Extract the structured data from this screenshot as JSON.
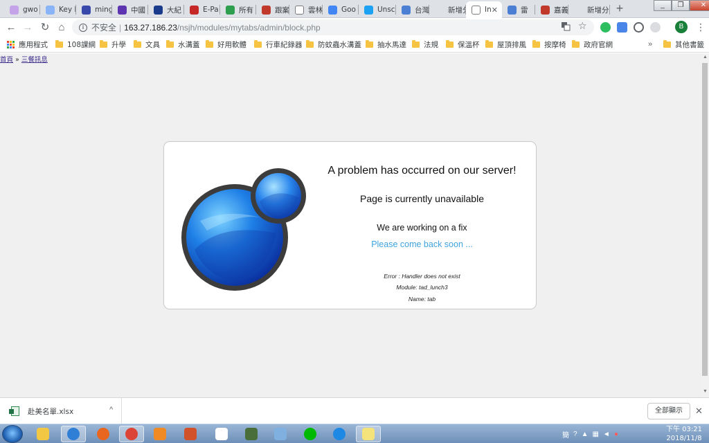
{
  "browser": {
    "tabs": [
      {
        "label": "gwo",
        "color": "#c5a3e8"
      },
      {
        "label": "Key I",
        "color": "#8ab4f8"
      },
      {
        "label": "ming",
        "color": "#3949ab"
      },
      {
        "label": "中國",
        "color": "#5e35b1"
      },
      {
        "label": "大紀",
        "color": "#1a3a8c"
      },
      {
        "label": "E-Pa",
        "color": "#c62828"
      },
      {
        "label": "所有",
        "color": "#2e9e4f"
      },
      {
        "label": "跟案",
        "color": "#c0392b"
      },
      {
        "label": "雲林",
        "color": "#ffffff"
      },
      {
        "label": "Goo",
        "color": "#4285f4"
      },
      {
        "label": "Unsc",
        "color": "#1da1f2"
      },
      {
        "label": "台灣",
        "color": "#4a7fd4"
      },
      {
        "label": "新增分頁",
        "color": "#dee1e6"
      },
      {
        "label": "In",
        "color": "#ffffff"
      },
      {
        "label": "雷",
        "color": "#4a7fd4"
      },
      {
        "label": "嘉義",
        "color": "#c0392b"
      },
      {
        "label": "新增分頁",
        "color": "#dee1e6"
      }
    ],
    "address": {
      "security_label": "不安全",
      "url_host": "163.27.186.23",
      "url_path": "/nsjh/modules/mytabs/admin/block.php"
    },
    "profile_initial": "B",
    "bookmarks": [
      {
        "label": "應用程式"
      },
      {
        "label": "108課綱"
      },
      {
        "label": "升學"
      },
      {
        "label": "文具"
      },
      {
        "label": "水溝蓋"
      },
      {
        "label": "好用軟體"
      },
      {
        "label": "行車紀錄器"
      },
      {
        "label": "防蚊蟲水溝蓋"
      },
      {
        "label": "抽水馬達"
      },
      {
        "label": "法規"
      },
      {
        "label": "保溫杯"
      },
      {
        "label": "屋頂排風"
      },
      {
        "label": "按摩椅"
      },
      {
        "label": "政府官網"
      }
    ],
    "bookmarks_more": "»",
    "other_bookmarks": "其他書籤"
  },
  "page": {
    "breadcrumb": {
      "home": "首頁",
      "separator": "»",
      "current": "三餐訊息"
    },
    "error": {
      "title": "A problem has occurred on our server!",
      "subtitle": "Page is currently unavailable",
      "working": "We are working on a fix",
      "come_back": "Please come back soon ...",
      "details": [
        "Error : Handler does not exist",
        "Module: tad_lunch3",
        "Name: tab"
      ]
    }
  },
  "downloads": {
    "file_name": "赴美名單.xlsx",
    "show_all_label": "全部顯示"
  },
  "taskbar": {
    "apps": [
      {
        "name": "file-explorer",
        "color": "#f2c744"
      },
      {
        "name": "internet-explorer",
        "color": "#2f7fd6"
      },
      {
        "name": "firefox",
        "color": "#e8661f"
      },
      {
        "name": "chrome",
        "color": "#db4437"
      },
      {
        "name": "media-player",
        "color": "#f08a24"
      },
      {
        "name": "powerpoint",
        "color": "#d1512a"
      },
      {
        "name": "apps-grid",
        "color": "#ffffff"
      },
      {
        "name": "pen-tool",
        "color": "#4a6e3a"
      },
      {
        "name": "notebook",
        "color": "#7fb0e0"
      },
      {
        "name": "line",
        "color": "#00b900"
      },
      {
        "name": "messenger",
        "color": "#1e88e5"
      },
      {
        "name": "sticky-notes",
        "color": "#f4e27a"
      }
    ],
    "tray_ime": "簡",
    "clock_time": "下午 03:21",
    "clock_date": "2018/11/8"
  }
}
